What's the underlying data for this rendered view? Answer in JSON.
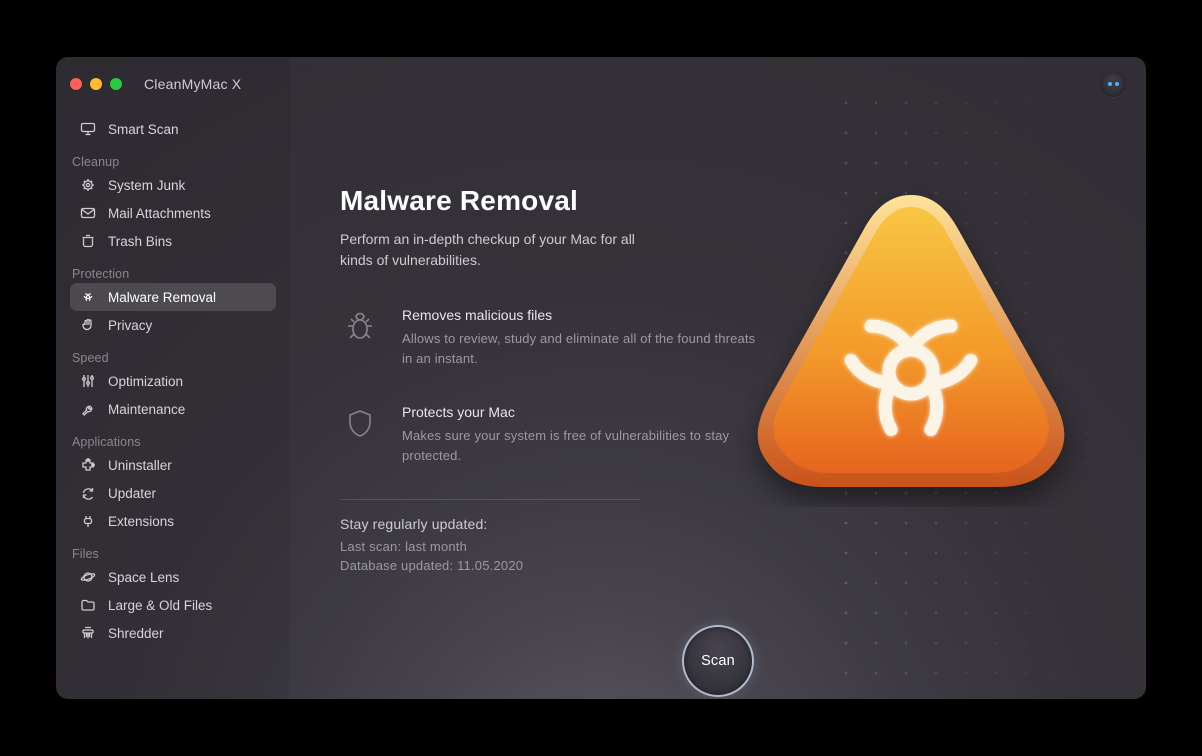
{
  "app": {
    "title": "CleanMyMac X"
  },
  "sidebar": {
    "smart_scan": "Smart Scan",
    "sections": [
      {
        "label": "Cleanup",
        "items": [
          {
            "id": "system-junk",
            "label": "System Junk",
            "icon": "gear-icon"
          },
          {
            "id": "mail-attachments",
            "label": "Mail Attachments",
            "icon": "mail-icon"
          },
          {
            "id": "trash-bins",
            "label": "Trash Bins",
            "icon": "trash-icon"
          }
        ]
      },
      {
        "label": "Protection",
        "items": [
          {
            "id": "malware-removal",
            "label": "Malware Removal",
            "icon": "biohazard-icon",
            "active": true
          },
          {
            "id": "privacy",
            "label": "Privacy",
            "icon": "hand-icon"
          }
        ]
      },
      {
        "label": "Speed",
        "items": [
          {
            "id": "optimization",
            "label": "Optimization",
            "icon": "sliders-icon"
          },
          {
            "id": "maintenance",
            "label": "Maintenance",
            "icon": "wrench-icon"
          }
        ]
      },
      {
        "label": "Applications",
        "items": [
          {
            "id": "uninstaller",
            "label": "Uninstaller",
            "icon": "puzzle-icon"
          },
          {
            "id": "updater",
            "label": "Updater",
            "icon": "refresh-icon"
          },
          {
            "id": "extensions",
            "label": "Extensions",
            "icon": "plug-icon"
          }
        ]
      },
      {
        "label": "Files",
        "items": [
          {
            "id": "space-lens",
            "label": "Space Lens",
            "icon": "planet-icon"
          },
          {
            "id": "large-old-files",
            "label": "Large & Old Files",
            "icon": "folder-icon"
          },
          {
            "id": "shredder",
            "label": "Shredder",
            "icon": "shredder-icon"
          }
        ]
      }
    ]
  },
  "main": {
    "title": "Malware Removal",
    "subtitle": "Perform an in-depth checkup of your Mac for all kinds of vulnerabilities.",
    "features": [
      {
        "title": "Removes malicious files",
        "desc": "Allows to review, study and eliminate all of the found threats in an instant."
      },
      {
        "title": "Protects your Mac",
        "desc": "Makes sure your system is free of vulnerabilities to stay protected."
      }
    ],
    "update_heading": "Stay regularly updated:",
    "last_scan": "Last scan: last month",
    "db_updated": "Database updated: 11.05.2020",
    "scan_button": "Scan"
  },
  "colors": {
    "accent": "#f5a623",
    "sidebar_active_bg": "rgba(255,255,255,0.14)"
  }
}
